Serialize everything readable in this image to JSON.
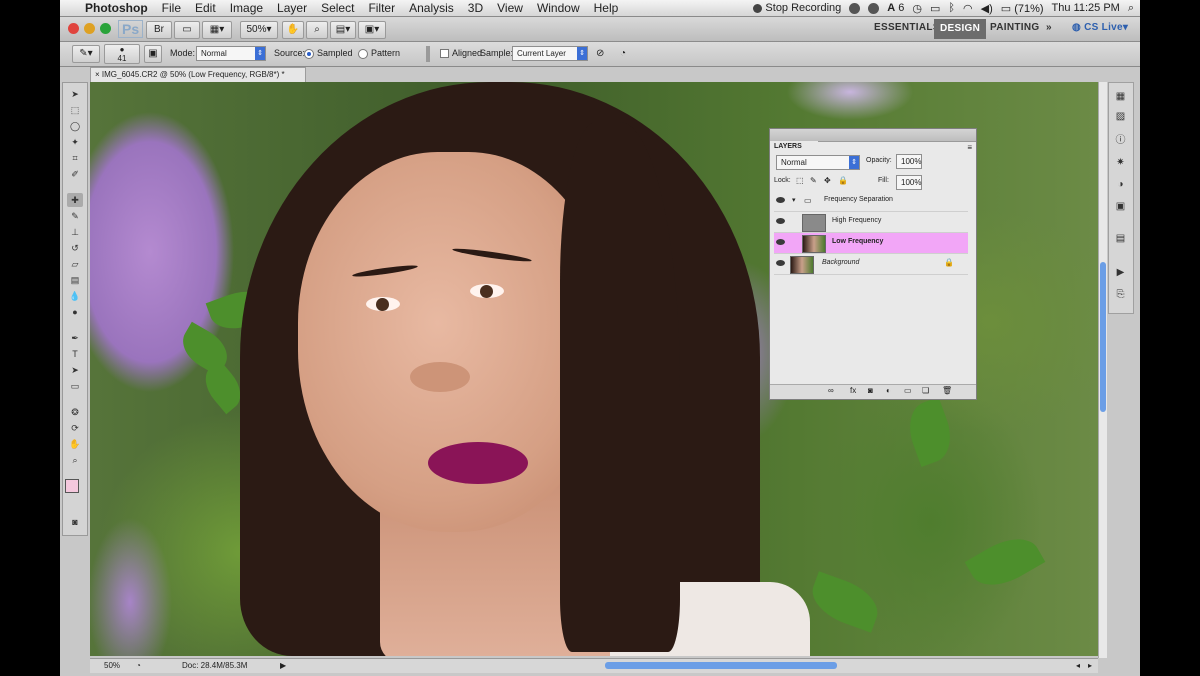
{
  "menubar": {
    "app_name": "Photoshop",
    "items": [
      "File",
      "Edit",
      "Image",
      "Layer",
      "Select",
      "Filter",
      "Analysis",
      "3D",
      "View",
      "Window",
      "Help"
    ],
    "stop_recording": "Stop Recording",
    "badge_number": "6",
    "battery": "(71%)",
    "clock": "Thu 11:25 PM"
  },
  "appbar": {
    "logo": "Ps",
    "zoom": "50%",
    "workspaces": [
      "ESSENTIALS",
      "DESIGN",
      "PAINTING"
    ],
    "active_workspace": "DESIGN",
    "more": "»",
    "cs_live": "CS Live"
  },
  "options": {
    "brush_size": "41",
    "mode_label": "Mode:",
    "mode_value": "Normal",
    "source_label": "Source:",
    "source_sampled": "Sampled",
    "source_pattern": "Pattern",
    "aligned_label": "Aligned",
    "sample_label": "Sample:",
    "sample_value": "Current Layer"
  },
  "document": {
    "tab_title": "IMG_6045.CR2 @ 50% (Low Frequency, RGB/8*) *"
  },
  "layers_panel": {
    "title": "LAYERS",
    "blend_mode": "Normal",
    "opacity_label": "Opacity:",
    "opacity_value": "100%",
    "lock_label": "Lock:",
    "fill_label": "Fill:",
    "fill_value": "100%",
    "group_name": "Frequency Separation",
    "layers": [
      {
        "name": "High Frequency",
        "selected": false
      },
      {
        "name": "Low Frequency",
        "selected": true
      },
      {
        "name": "Background",
        "selected": false
      }
    ]
  },
  "status": {
    "zoom": "50%",
    "doc_info": "Doc: 28.4M/85.3M"
  },
  "colors": {
    "selected_layer": "#f2a6f7",
    "accent_blue": "#3b6fd6"
  }
}
